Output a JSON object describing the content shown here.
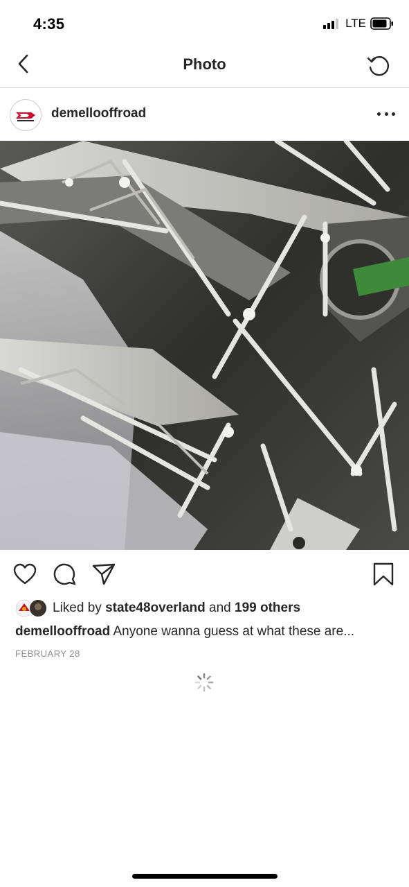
{
  "status_bar": {
    "time": "4:35",
    "network": "LTE",
    "icons": [
      "signal-icon",
      "battery-icon"
    ]
  },
  "nav": {
    "title": "Photo",
    "back_icon": "chevron-left-icon",
    "refresh_icon": "refresh-icon"
  },
  "post": {
    "username": "demellooffroad",
    "avatar_icon": "dd-logo-icon",
    "more_icon": "more-horizontal-icon",
    "photo_alt": "metal fabricated truss parts",
    "actions": {
      "like_icon": "heart-icon",
      "comment_icon": "comment-icon",
      "share_icon": "send-icon",
      "save_icon": "bookmark-icon"
    },
    "likes": {
      "prefix": "Liked by",
      "user": "state48overland",
      "joiner": "and",
      "others": "199 others"
    },
    "caption": {
      "username": "demellooffroad",
      "text": "Anyone wanna guess at what these are..."
    },
    "date": "FEBRUARY 28"
  },
  "colors": {
    "text": "#262626",
    "secondary": "#8e8e8e",
    "divider": "#dbdbdb",
    "brand_red": "#c8102e"
  }
}
